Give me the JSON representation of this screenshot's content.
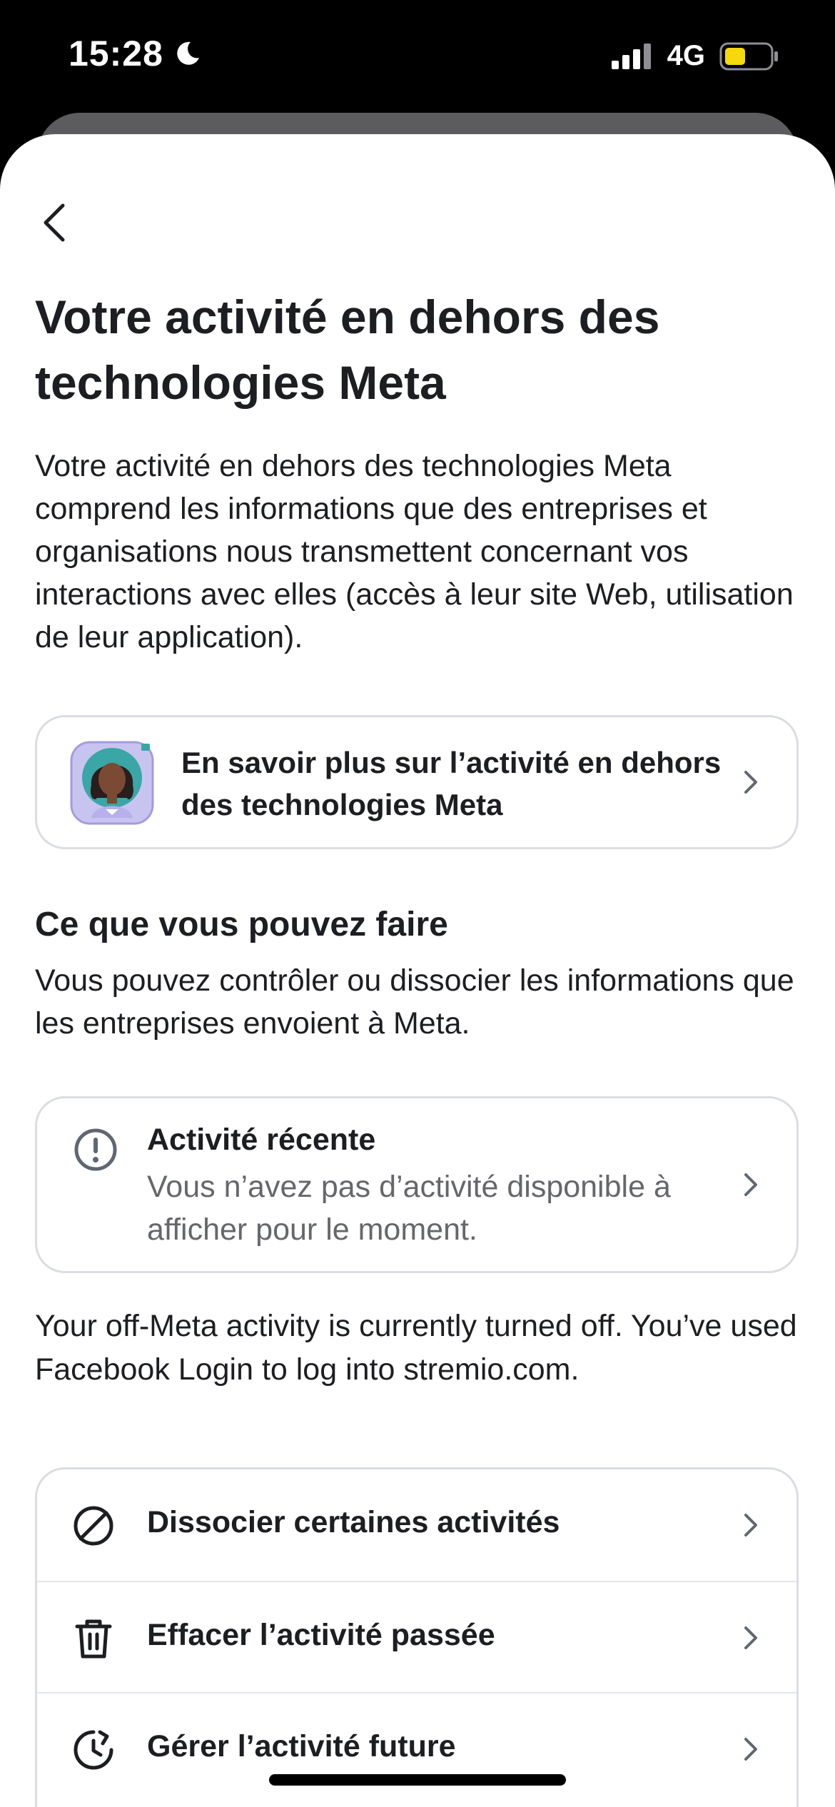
{
  "status_bar": {
    "time": "15:28",
    "network": "4G",
    "icons": [
      "moon-icon",
      "signal-icon",
      "battery-icon"
    ],
    "battery_color": "#f5d90a"
  },
  "header": {
    "back_icon": "chevron-left-icon",
    "title": "Votre activité en dehors des technologies Meta"
  },
  "intro": {
    "text": "Votre activité en dehors des technologies Meta comprend les informations que des entreprises et organisations nous transmettent concernant vos interactions avec elles (accès à leur site Web, utilisation de leur application)."
  },
  "learn_more": {
    "label": "En savoir plus sur l’activité en dehors des technologies Meta",
    "icon": "avatar-illustration"
  },
  "what_you_can_do": {
    "heading": "Ce que vous pouvez faire",
    "description": "Vous pouvez contrôler ou dissocier les informations que les entreprises envoient à Meta."
  },
  "recent_activity": {
    "icon": "info-icon",
    "title": "Activité récente",
    "subtitle": "Vous n’avez pas d’activité disponible à afficher pour le moment."
  },
  "off_meta_status": {
    "text": "Your off-Meta activity is currently turned off. You’ve used Facebook Login to log into stremio.com."
  },
  "actions": [
    {
      "label": "Dissocier certaines activités",
      "icon": "block-icon"
    },
    {
      "label": "Effacer l’activité passée",
      "icon": "trash-icon"
    },
    {
      "label": "Gérer l’activité future",
      "icon": "clock-refresh-icon"
    }
  ],
  "colors": {
    "text_primary": "#1c1e21",
    "text_secondary": "#65676b",
    "border": "#dadde1",
    "icon_gray": "#606770"
  }
}
